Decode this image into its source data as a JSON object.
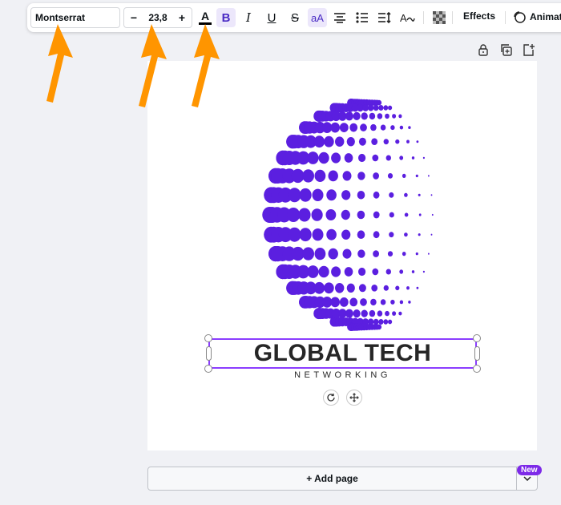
{
  "toolbar": {
    "font_name": "Montserrat",
    "font_size": "23,8",
    "decrease_label": "−",
    "increase_label": "+",
    "color_letter": "A",
    "bold_letter": "B",
    "italic_letter": "I",
    "underline_letter": "U",
    "strike_letter": "S",
    "case_label": "aA",
    "effects_label": "Effects",
    "animate_label": "Animate"
  },
  "design": {
    "title": "GLOBAL TECH",
    "subtitle": "NETWORKING"
  },
  "footer": {
    "add_page_label": "+ Add page",
    "new_badge": "New"
  },
  "colors": {
    "accent": "#8b3dff",
    "globe": "#5b1fe0",
    "arrow": "#ff9500"
  }
}
